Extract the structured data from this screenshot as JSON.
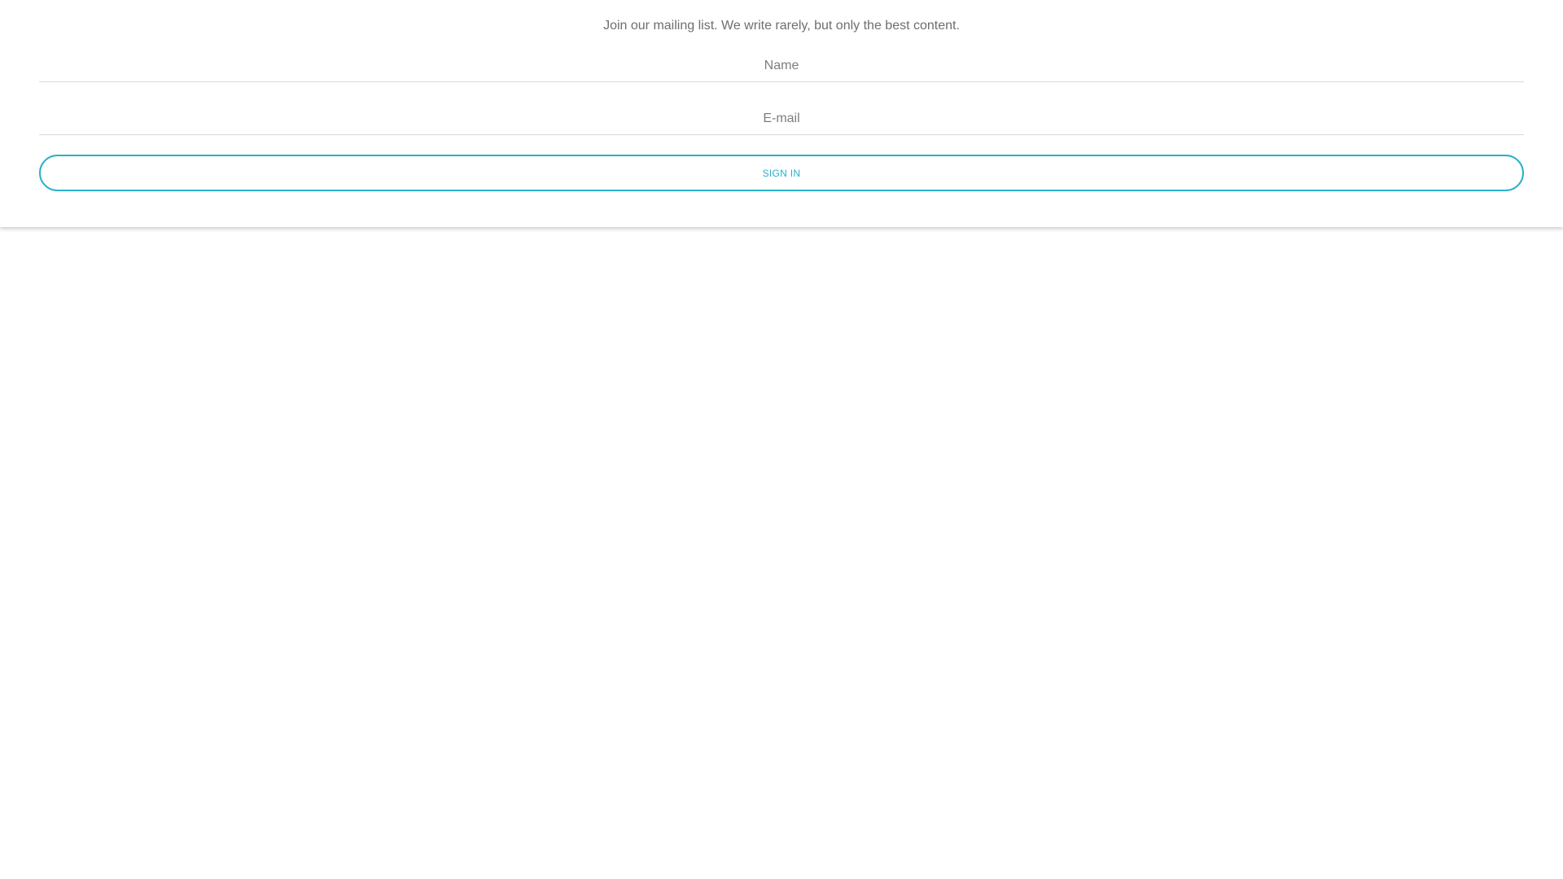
{
  "signup": {
    "intro_text": "Join our mailing list. We write rarely, but only the best content.",
    "name_field": {
      "placeholder": "Name",
      "value": ""
    },
    "email_field": {
      "placeholder": "E-mail",
      "value": ""
    },
    "submit_label": "SIGN IN"
  },
  "colors": {
    "accent": "#29afc8",
    "text": "#6e6e6e",
    "divider": "#d9d9d9",
    "background": "#ffffff"
  }
}
